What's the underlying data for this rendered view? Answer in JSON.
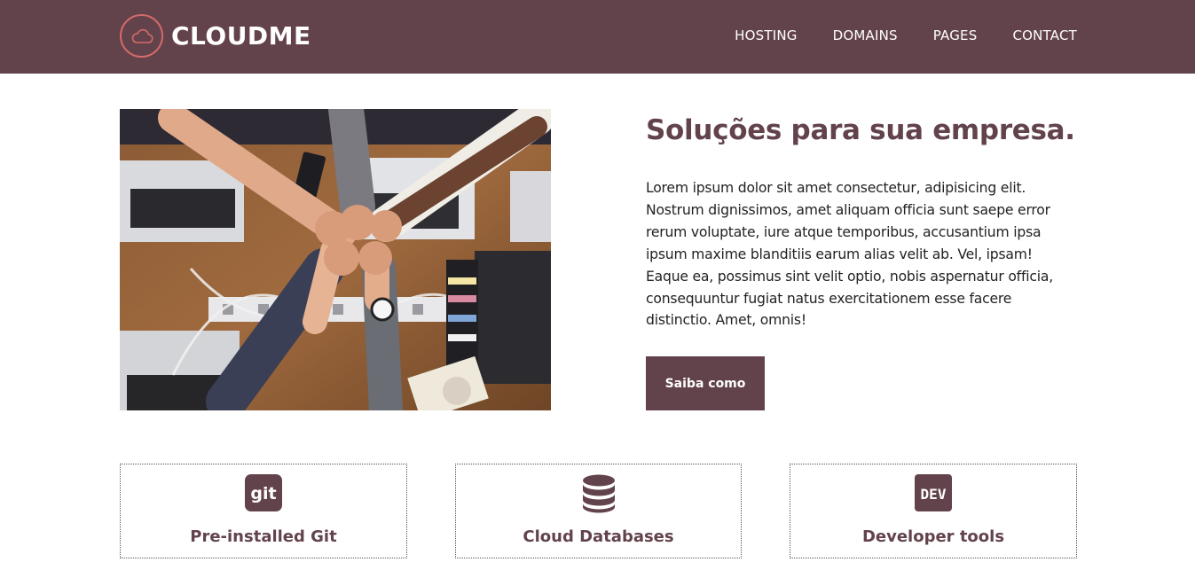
{
  "brand": {
    "name": "CLOUDME",
    "logo_icon": "cloud-icon"
  },
  "nav": {
    "items": [
      {
        "label": "HOSTING"
      },
      {
        "label": "DOMAINS"
      },
      {
        "label": "PAGES"
      },
      {
        "label": "CONTACT"
      }
    ]
  },
  "hero": {
    "image_icon": "team-fist-bump-photo",
    "title": "Soluções para sua empresa.",
    "body": "Lorem ipsum dolor sit amet consectetur, adipisicing elit. Nostrum dignissimos, amet aliquam officia sunt saepe error rerum voluptate, iure atque temporibus, accusantium ipsa ipsum maxime blanditiis earum alias velit ab. Vel, ipsam! Eaque ea, possimus sint velit optio, nobis aspernatur officia, consequuntur fugiat natus exercitationem esse facere distinctio. Amet, omnis!",
    "cta_label": "Saiba como"
  },
  "features": [
    {
      "title": "Pre-installed Git",
      "icon": "git-icon",
      "icon_text": "git"
    },
    {
      "title": "Cloud Databases",
      "icon": "database-icon"
    },
    {
      "title": "Developer tools",
      "icon": "dev-icon",
      "icon_text": "DEV"
    }
  ],
  "colors": {
    "primary": "#63434b",
    "accent": "#d46a6a",
    "background": "#ffffff"
  }
}
